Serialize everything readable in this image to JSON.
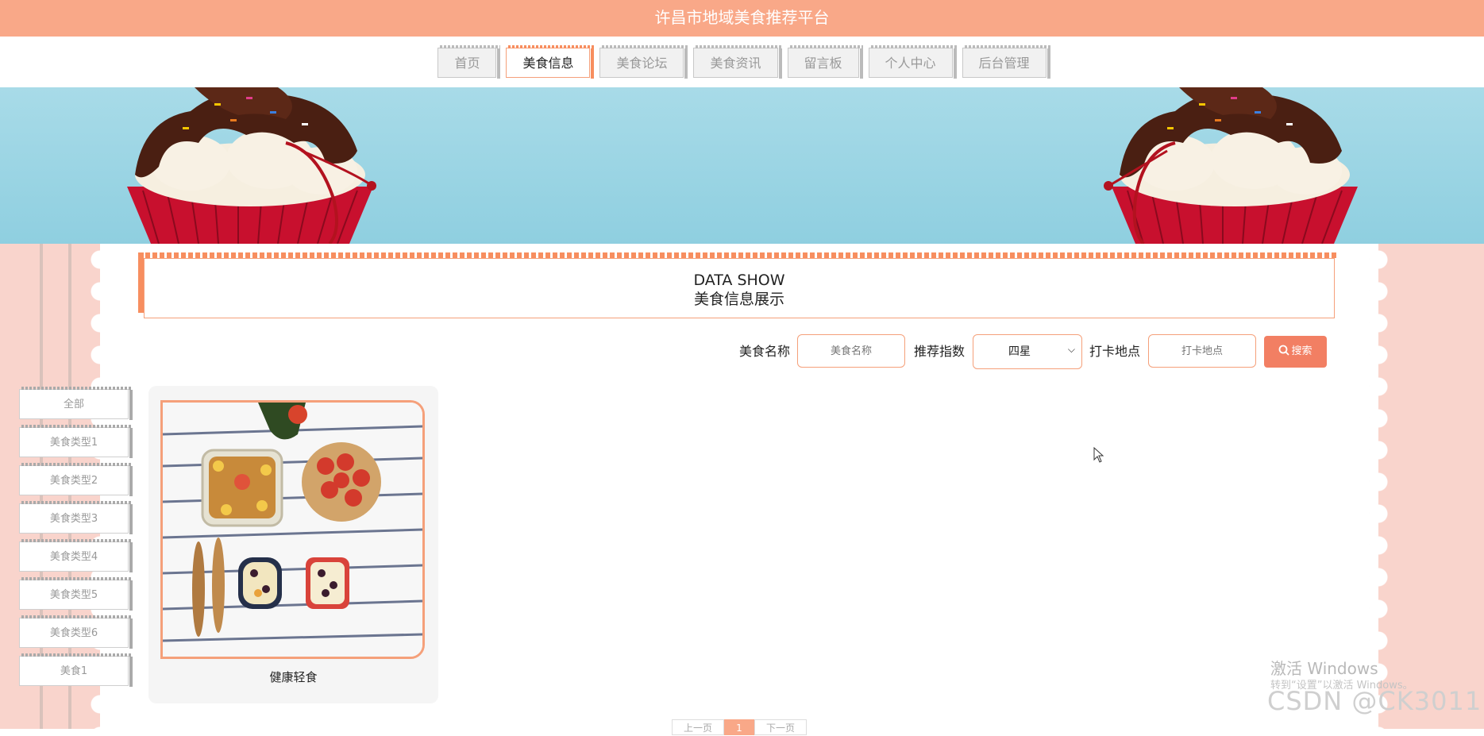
{
  "site": {
    "title": "许昌市地域美食推荐平台"
  },
  "nav": {
    "items": [
      {
        "label": "首页"
      },
      {
        "label": "美食信息",
        "active": true
      },
      {
        "label": "美食论坛"
      },
      {
        "label": "美食资讯"
      },
      {
        "label": "留言板"
      },
      {
        "label": "个人中心"
      },
      {
        "label": "后台管理"
      }
    ]
  },
  "heading": {
    "en": "DATA SHOW",
    "cn": "美食信息展示"
  },
  "search": {
    "name_label": "美食名称",
    "name_placeholder": "美食名称",
    "rating_label": "推荐指数",
    "rating_value": "四星",
    "location_label": "打卡地点",
    "location_placeholder": "打卡地点",
    "button_label": "搜索"
  },
  "categories": [
    "全部",
    "美食类型1",
    "美食类型2",
    "美食类型3",
    "美食类型4",
    "美食类型5",
    "美食类型6",
    "美食1"
  ],
  "card": {
    "title": "健康轻食"
  },
  "pager": {
    "prev": "上一页",
    "current": "1",
    "next": "下一页"
  },
  "watermark": {
    "activate": "激活 Windows",
    "activate_hint": "转到“设置”以激活 Windows。",
    "csdn": "CSDN @CK3011"
  },
  "colors": {
    "accent": "#f9a888",
    "border": "#f5a07a",
    "button": "#f27f63"
  }
}
